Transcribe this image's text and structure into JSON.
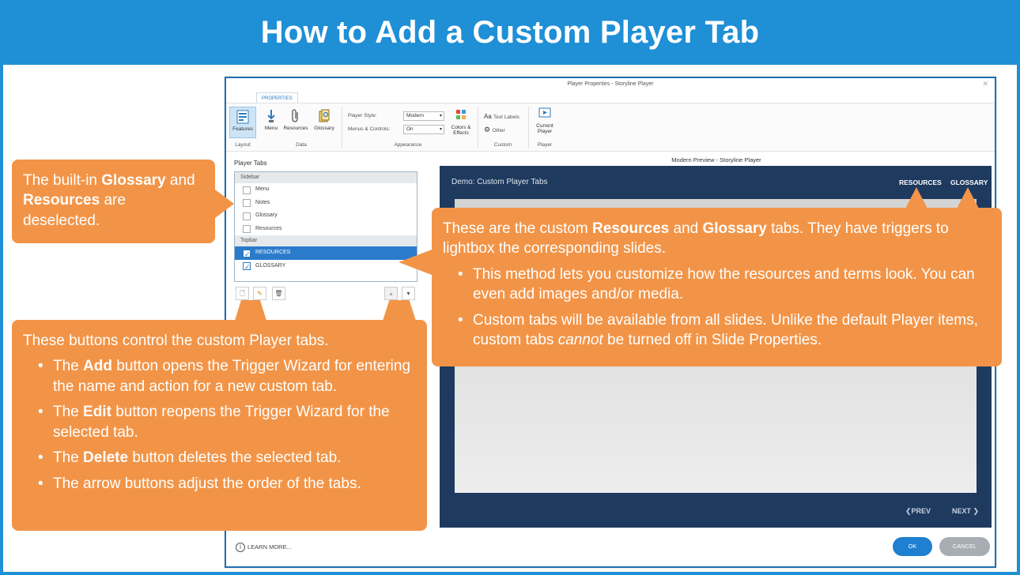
{
  "page_title": "How to Add a Custom Player Tab",
  "dialog": {
    "title": "Player Properties - Storyline Player",
    "ribbon_tab": "PROPERTIES",
    "ribbon": {
      "features": "Features",
      "menu": "Menu",
      "resources": "Resources",
      "glossary": "Glossary",
      "player_style_label": "Player Style:",
      "player_style_value": "Modern",
      "menus_controls_label": "Menus & Controls:",
      "menus_controls_value": "On",
      "colors_effects": "Colors & Effects",
      "text_labels": "Text Labels",
      "other": "Other",
      "current_player": "Current Player",
      "group_layout": "Layout",
      "group_data": "Data",
      "group_appearance": "Appearance",
      "group_custom": "Custom",
      "group_player": "Player"
    },
    "player_tabs": {
      "title": "Player Tabs",
      "sidebar_header": "Sidebar",
      "sidebar_items": [
        "Menu",
        "Notes",
        "Glossary",
        "Resources"
      ],
      "topbar_header": "Topbar",
      "topbar_items": [
        "RESOURCES",
        "GLOSSARY"
      ]
    },
    "preview": {
      "label": "Modern Preview - Storyline Player",
      "course_title": "Demo: Custom Player Tabs",
      "tab_resources": "RESOURCES",
      "tab_glossary": "GLOSSARY",
      "prev": "PREV",
      "next": "NEXT"
    },
    "footer": {
      "learn_more": "LEARN MORE...",
      "ok": "OK",
      "cancel": "CANCEL"
    }
  },
  "callouts": {
    "builtin": {
      "pre": "The built-in ",
      "glossary": "Glossary",
      "and": " and ",
      "resources": "Resources",
      "post": " are deselected."
    },
    "custom_tabs": {
      "pre": "These are the custom ",
      "resources": "Resources",
      "and": " and ",
      "glossary": "Glossary",
      "post": " tabs. They have triggers to lightbox the corresponding slides.",
      "bullet1": "This method lets you customize how the resources and terms look. You can even add images and/or media.",
      "bullet2_pre": "Custom tabs will be available from all slides. Unlike the default Player items, custom tabs ",
      "bullet2_em": "cannot",
      "bullet2_post": " be turned off in Slide Properties."
    },
    "buttons": {
      "intro": "These buttons control the custom Player tabs.",
      "add_pre": "The ",
      "add_b": "Add",
      "add_post": " button opens the Trigger Wizard for entering the name and action for a new custom tab.",
      "edit_pre": "The ",
      "edit_b": "Edit",
      "edit_post": " button reopens the Trigger Wizard for the selected tab.",
      "delete_pre": "The ",
      "delete_b": "Delete",
      "delete_post": " button deletes the selected tab.",
      "arrows": "The arrow buttons adjust the order of the tabs."
    }
  },
  "colors": {
    "brand_blue": "#1f8fd6",
    "callout_orange": "#f29447",
    "player_navy": "#1e3a5f",
    "selection_blue": "#2b7bcc"
  }
}
